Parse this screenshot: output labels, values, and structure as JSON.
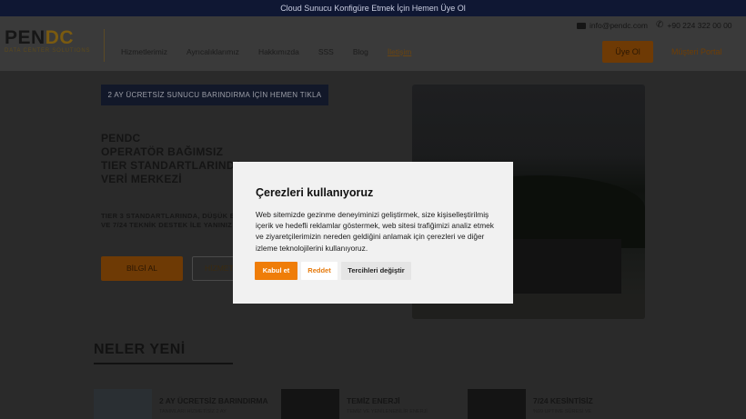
{
  "topbar": {
    "text": "Cloud Sunucu Konfigüre Etmek İçin Hemen Üye Ol"
  },
  "header": {
    "logo_main": "PEN",
    "logo_accent": "DC",
    "logo_sub": "DATA CENTER SOLUTIONS",
    "nav": [
      "Hizmetlerimiz",
      "Ayrıcalıklarımız",
      "Hakkımızda",
      "SSS",
      "Blog",
      "İletişim"
    ],
    "email": "info@pendc.com",
    "phone": "+90 224 322 00 00",
    "signup_label": "Üye Ol",
    "portal_label": "Müşteri Portal"
  },
  "hero": {
    "cta": "2 AY ÜCRETSİZ SUNUCU BARINDIRMA İÇİN HEMEN TIKLA",
    "title_lines": [
      "PENDC",
      "OPERATÖR BAĞIMSIZ",
      "TIER STANDARTLARINDA",
      "VERİ MERKEZİ"
    ],
    "sub_lines": [
      "TIER 3 STANDARTLARINDA, DÜŞÜK EL",
      "VE 7/24 TEKNİK DESTEK İLE YANINIZ"
    ],
    "info_button": "BİLGİ AL",
    "services_button": "HİZMETL"
  },
  "news": {
    "heading": "NELER YENİ",
    "cards": [
      {
        "title": "2 AY ÜCRETSİZ BARINDIRMA",
        "text": "TANIMLARI HİZMETİSİZ 2 AY"
      },
      {
        "title": "TEMİZ ENERJİ",
        "text": "TEMİZ VE YENİLENEBİLİR ENERJİ"
      },
      {
        "title": "7/24 KESİNTİSİZ",
        "text": "%99 UPTIME SÜRESİ VE"
      }
    ]
  },
  "cookie": {
    "title": "Çerezleri kullanıyoruz",
    "text": "Web sitemizde gezinme deneyiminizi geliştirmek, size kişiselleştirilmiş içerik ve hedefli reklamlar göstermek, web sitesi trafiğimizi analiz etmek ve ziyaretçilerimizin nereden geldiğini anlamak için çerezleri ve diğer izleme teknolojilerini kullanıyoruz.",
    "accept": "Kabul et",
    "reject": "Reddet",
    "prefs": "Tercihleri değiştir"
  },
  "colors": {
    "accent": "#ef7d09",
    "topbar": "#0f1733"
  }
}
